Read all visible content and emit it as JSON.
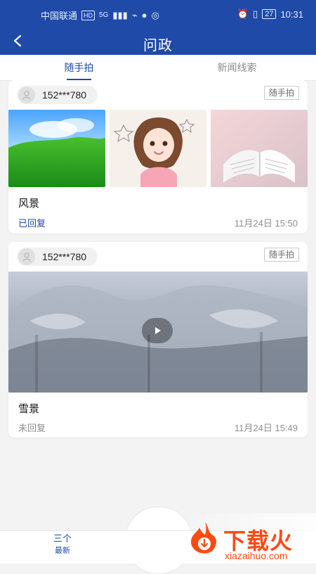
{
  "status_bar": {
    "carrier": "中国联通",
    "hd_label": "HD",
    "network_label": "5G",
    "battery": "27",
    "time": "10:31"
  },
  "navbar": {
    "title": "问政"
  },
  "tabs": [
    {
      "label": "随手拍",
      "active": true
    },
    {
      "label": "新闻线索",
      "active": false
    }
  ],
  "cards": [
    {
      "user": "152***780",
      "tag": "随手拍",
      "title": "风景",
      "status": "已回复",
      "status_color": "#1f4aa8",
      "time": "11月24日 15:50",
      "media": [
        "landscape-image",
        "cartoon-girl-image",
        "open-book-image"
      ]
    },
    {
      "user": "152***780",
      "tag": "随手拍",
      "title": "雪景",
      "status": "未回复",
      "status_color": "#8f8f8f",
      "time": "11月24日 15:49",
      "media": [
        "video-thumbnail"
      ]
    }
  ],
  "bottom_nav": {
    "item_label": "最新",
    "item_icon_text": "三个"
  },
  "watermark": {
    "text": "下载火",
    "domain": "xiazaihuo.com"
  },
  "colors": {
    "brand": "#1f4aa8",
    "accent": "#ff4a12"
  }
}
